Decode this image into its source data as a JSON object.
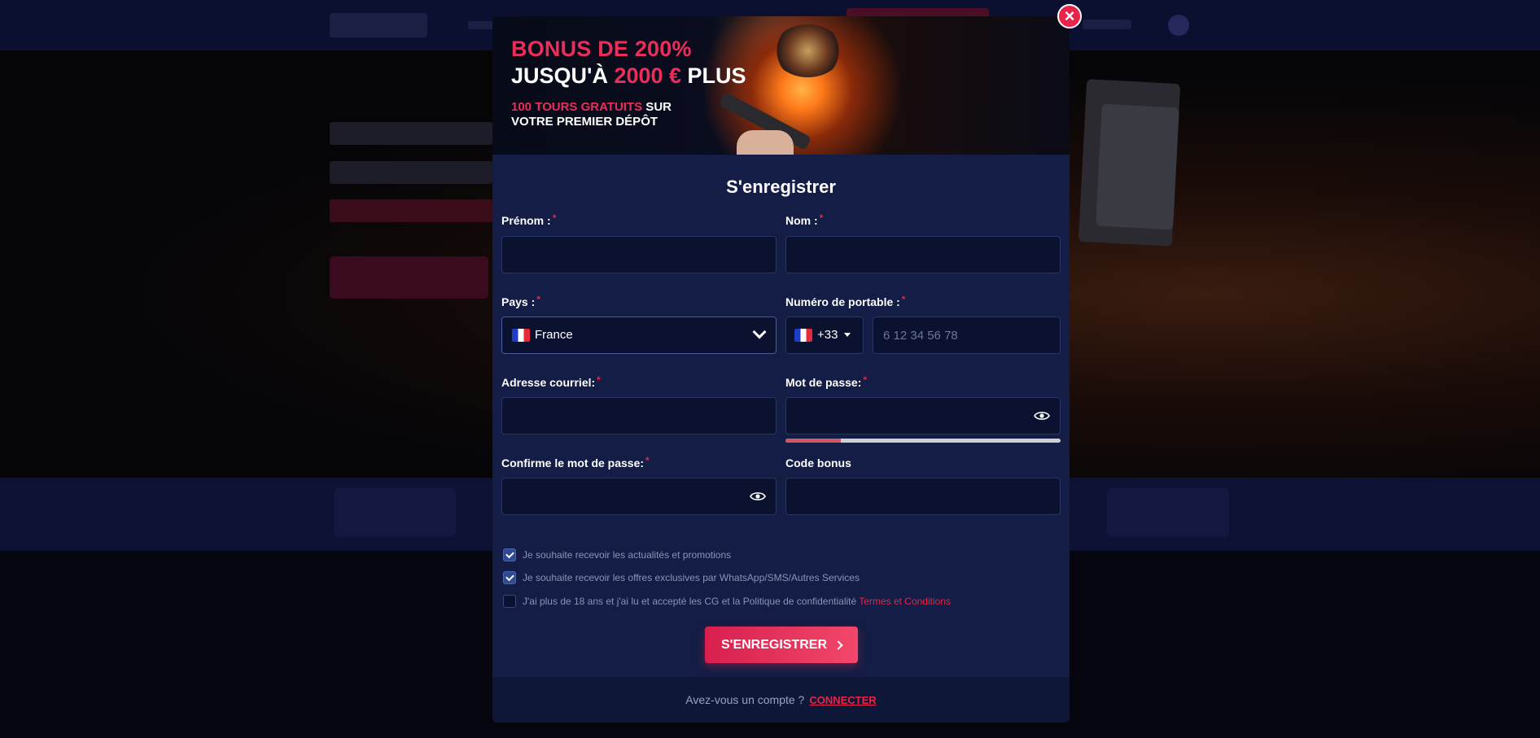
{
  "banner": {
    "line1": "BONUS DE 200%",
    "line2_prefix": "JUSQU'À ",
    "line2_amount": "2000 €",
    "line2_suffix": " PLUS",
    "line3_red": "100 TOURS GRATUITS",
    "line3_white": " SUR",
    "line4": "VOTRE PREMIER DÉPÔT"
  },
  "close_icon": "×",
  "form": {
    "title": "S'enregistrer",
    "first_name": {
      "label": "Prénom :",
      "value": ""
    },
    "last_name": {
      "label": "Nom :",
      "value": ""
    },
    "country": {
      "label": "Pays :",
      "value": "France",
      "flag": "fr-flag-icon"
    },
    "mobile": {
      "label": "Numéro de portable :",
      "code": "+33",
      "placeholder": "6 12 34 56 78",
      "value": ""
    },
    "email": {
      "label": "Adresse courriel:",
      "value": ""
    },
    "password": {
      "label": "Mot de passe:",
      "value": "",
      "strength": 0.2
    },
    "confirm_password": {
      "label": "Confirme le mot de passe:",
      "value": ""
    },
    "bonus_code": {
      "label": "Code bonus",
      "value": ""
    },
    "required_mark": "*"
  },
  "checkboxes": [
    {
      "label": "Je souhaite recevoir les actualités et promotions",
      "checked": true
    },
    {
      "label": "Je souhaite recevoir les offres exclusives par WhatsApp/SMS/Autres Services",
      "checked": true
    },
    {
      "label": "J'ai plus de 18 ans et j'ai lu et accepté les CG et la Politique de confidentialité ",
      "link": "Termes et Conditions",
      "checked": false
    }
  ],
  "submit": {
    "label": "S'ENREGISTRER"
  },
  "footer": {
    "question": "Avez-vous un compte ?",
    "link": "CONNECTER"
  },
  "colors": {
    "accent": "#e8244a",
    "modal_bg": "#141d45",
    "input_bg": "#0b1230"
  }
}
